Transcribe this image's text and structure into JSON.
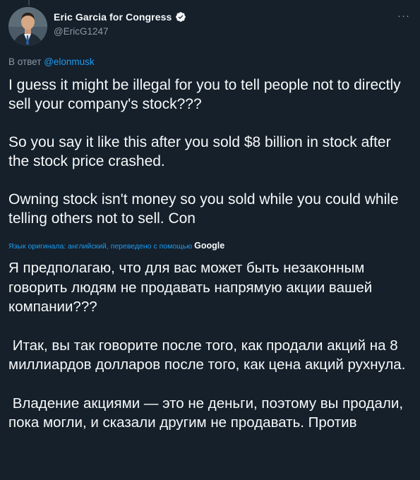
{
  "author": {
    "display_name": "Eric Garcia for Congress",
    "handle": "@EricG1247",
    "verified": true
  },
  "header": {
    "more_label": "···"
  },
  "reply": {
    "prefix": "В ответ",
    "mention": "@elonmusk"
  },
  "tweet": {
    "paragraphs": [
      "I guess it might be illegal for you to tell people not to directly sell your company's stock???",
      "So you say it like this after you sold $8 billion in stock after the stock price crashed.",
      "Owning stock isn't money so you sold while you could while telling others not to sell. Con"
    ]
  },
  "translation": {
    "note": "Язык оригинала: английский, переведено с помощью",
    "provider": "Google",
    "paragraphs": [
      "Я предполагаю, что для вас может быть незаконным говорить людям не продавать напрямую акции вашей компании???",
      " Итак, вы так говорите после того, как продали акций на 8 миллиардов долларов после того, как цена акций рухнула.",
      " Владение акциями — это не деньги, поэтому вы продали, пока могли, и сказали другим не продавать. Против"
    ]
  },
  "colors": {
    "background": "#15202b",
    "text": "#f7f9f9",
    "secondary": "#8b98a5",
    "accent": "#1d9bf0"
  },
  "icons": {
    "verified": "verified-badge-icon",
    "more": "more-options-icon"
  }
}
